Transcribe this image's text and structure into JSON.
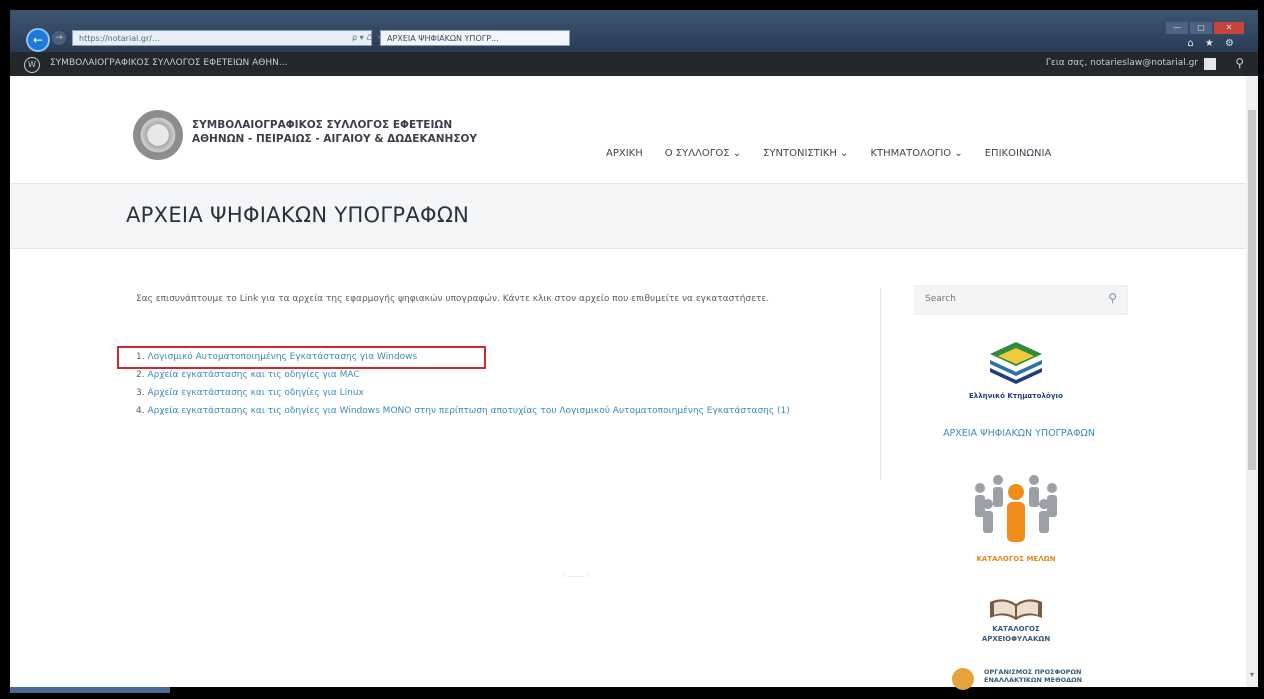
{
  "browser": {
    "address": "https://notarial.gr/...",
    "addr_controls": "ρ ▾ ♺ ✕",
    "tab_title": "ΑΡΧΕΙΑ ΨΗΦΙΑΚΩΝ ΥΠΟΓΡ...",
    "back_glyph": "←",
    "forward_glyph": "→",
    "toolbar_icons": "⌂ ★ ⚙",
    "window_controls": [
      "—",
      "▢",
      "✕"
    ]
  },
  "admin_bar": {
    "wp_icon": "W",
    "site_name": "ΣΥΜΒΟΛΑΙΟΓΡΑΦΙΚΟΣ ΣΥΛΛΟΓΟΣ ΕΦΕΤΕΙΩΝ ΑΘΗΝ...",
    "greeting": "Γεια σας, notarieslaw@notarial.gr",
    "search_glyph": "⚲"
  },
  "site": {
    "logo_line1": "ΣΥΜΒΟΛΑΙΟΓΡΑΦΙΚΟΣ ΣΥΛΛΟΓΟΣ ΕΦΕΤΕΙΩΝ",
    "logo_line2": "ΑΘΗΝΩΝ - ΠΕΙΡΑΙΩΣ - ΑΙΓΑΙΟΥ & ΔΩΔΕΚΑΝΗΣΟΥ",
    "nav": [
      {
        "label": "ΑΡΧΙΚΗ"
      },
      {
        "label": "Ο ΣΥΛΛΟΓΟΣ ⌄"
      },
      {
        "label": "ΣΥΝΤΟΝΙΣΤΙΚΗ ⌄"
      },
      {
        "label": "ΚΤΗΜΑΤΟΛΟΓΙΟ ⌄"
      },
      {
        "label": "ΕΠΙΚΟΙΝΩΝΙΑ"
      }
    ]
  },
  "page": {
    "title": "ΑΡΧΕΙΑ ΨΗΦΙΑΚΩΝ ΥΠΟΓΡΑΦΩΝ",
    "intro": "Σας επισυνάπτουμε το Link για τα αρχεία της εφαρμογής ψηφιακών υπογραφών. Κάντε κλικ στον αρχείο που επιθυμείτε να εγκαταστήσετε.",
    "links": [
      {
        "num": "1.",
        "label": "Λογισμικό Αυτοματοποιημένης Εγκατάστασης για Windows"
      },
      {
        "num": "2.",
        "label": "Αρχεία εγκατάστασης και τις οδηγίες για MAC"
      },
      {
        "num": "3.",
        "label": "Αρχεία εγκατάστασης και τις οδηγίες για Linux"
      },
      {
        "num": "4.",
        "label": "Αρχεία εγκατάστασης και τις οδηγίες για Windows ΜΟΝΟ στην περίπτωση αποτυχίας του Λογισμικού Αυτοματοποιημένης Εγκατάστασης (1)"
      }
    ],
    "faint_control": "‹ ⎯⎯⎯⎯⎯ ›"
  },
  "sidebar": {
    "search_placeholder": "Search",
    "search_glyph": "⚲",
    "ktima_caption": "Ελληνικό Κτηματολόγιο",
    "signatures_link": "ΑΡΧΕΙΑ ΨΗΦΙΑΚΩΝ ΥΠΟΓΡΑΦΩΝ",
    "members_caption": "ΚΑΤΑΛΟΓΟΣ ΜΕΛΩΝ",
    "archives_caption_1": "ΚΑΤΑΛΟΓΟΣ",
    "archives_caption_2": "ΑΡΧΕΙΟΦΥΛΑΚΩΝ",
    "org_caption_1": "ΟΡΓΑΝΙΣΜΟΣ ΠΡΟΣΦΟΡΩΝ",
    "org_caption_2": "ΕΝΑΛΛΑΚΤΙΚΩΝ ΜΕΘΟΔΩΝ"
  },
  "colors": {
    "link": "#3b8bbf",
    "highlight": "#d0282e",
    "admin_bar": "#23282d",
    "members_accent": "#e08a1c"
  }
}
